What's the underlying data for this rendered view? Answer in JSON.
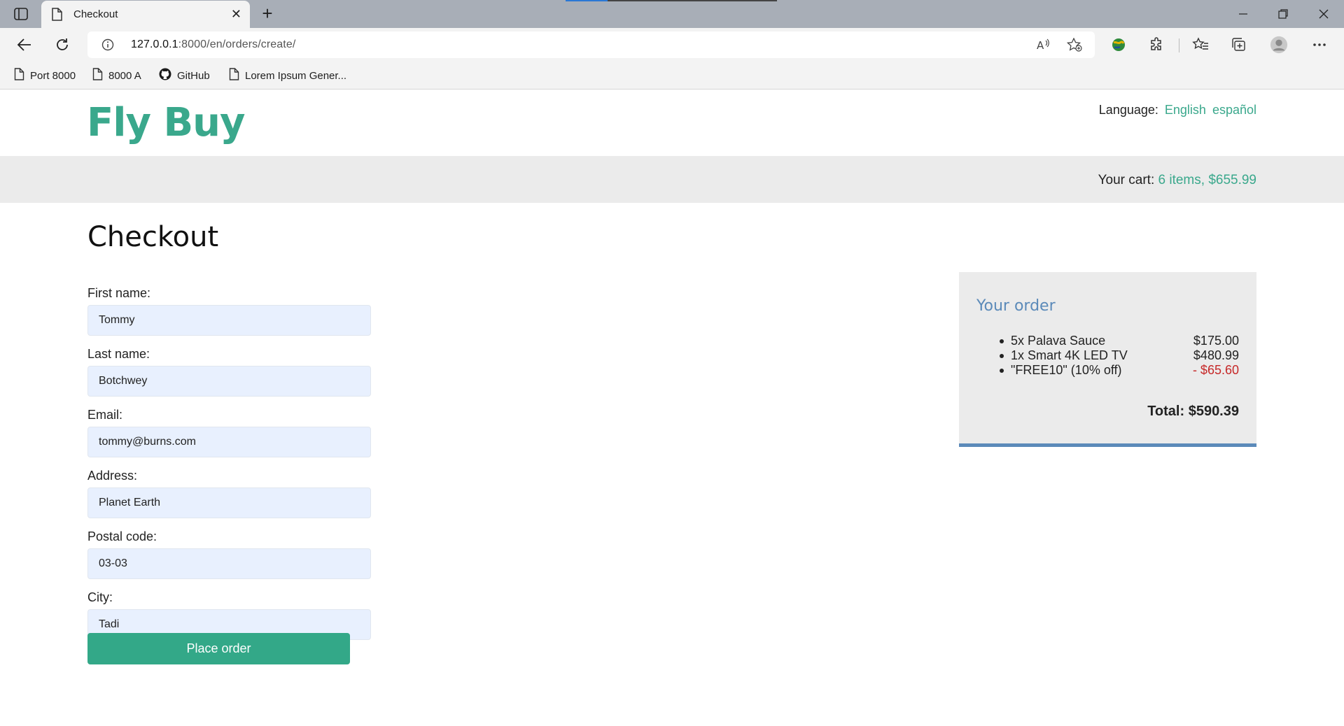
{
  "browser": {
    "tab_title": "Checkout",
    "url_host": "127.0.0.1",
    "url_path": ":8000/en/orders/create/",
    "bookmarks": [
      {
        "label": "Port 8000",
        "icon": "page-icon"
      },
      {
        "label": "8000 A",
        "icon": "page-icon"
      },
      {
        "label": "GitHub",
        "icon": "github-icon"
      },
      {
        "label": "Lorem Ipsum Gener...",
        "icon": "page-icon"
      }
    ]
  },
  "header": {
    "logo": "Fly Buy",
    "language_label": "Language:",
    "languages": [
      "English",
      "español"
    ]
  },
  "cart": {
    "label": "Your cart:",
    "summary": "6 items, $655.99"
  },
  "checkout": {
    "title": "Checkout",
    "fields": [
      {
        "label": "First name:",
        "value": "Tommy"
      },
      {
        "label": "Last name:",
        "value": "Botchwey"
      },
      {
        "label": "Email:",
        "value": "tommy@burns.com"
      },
      {
        "label": "Address:",
        "value": "Planet Earth"
      },
      {
        "label": "Postal code:",
        "value": "03-03"
      },
      {
        "label": "City:",
        "value": "Tadi"
      }
    ],
    "submit_label": "Place order"
  },
  "order": {
    "title": "Your order",
    "items": [
      {
        "name": "5x Palava Sauce",
        "price": "$175.00"
      },
      {
        "name": "1x Smart 4K LED TV",
        "price": "$480.99"
      },
      {
        "name": "\"FREE10\" (10% off)",
        "price": "- $65.60"
      }
    ],
    "total": "Total: $590.39"
  },
  "colors": {
    "brand": "#3aa88c",
    "order_accent": "#5b8ab9",
    "discount": "#c62828",
    "cartbar_bg": "#ebebeb"
  }
}
